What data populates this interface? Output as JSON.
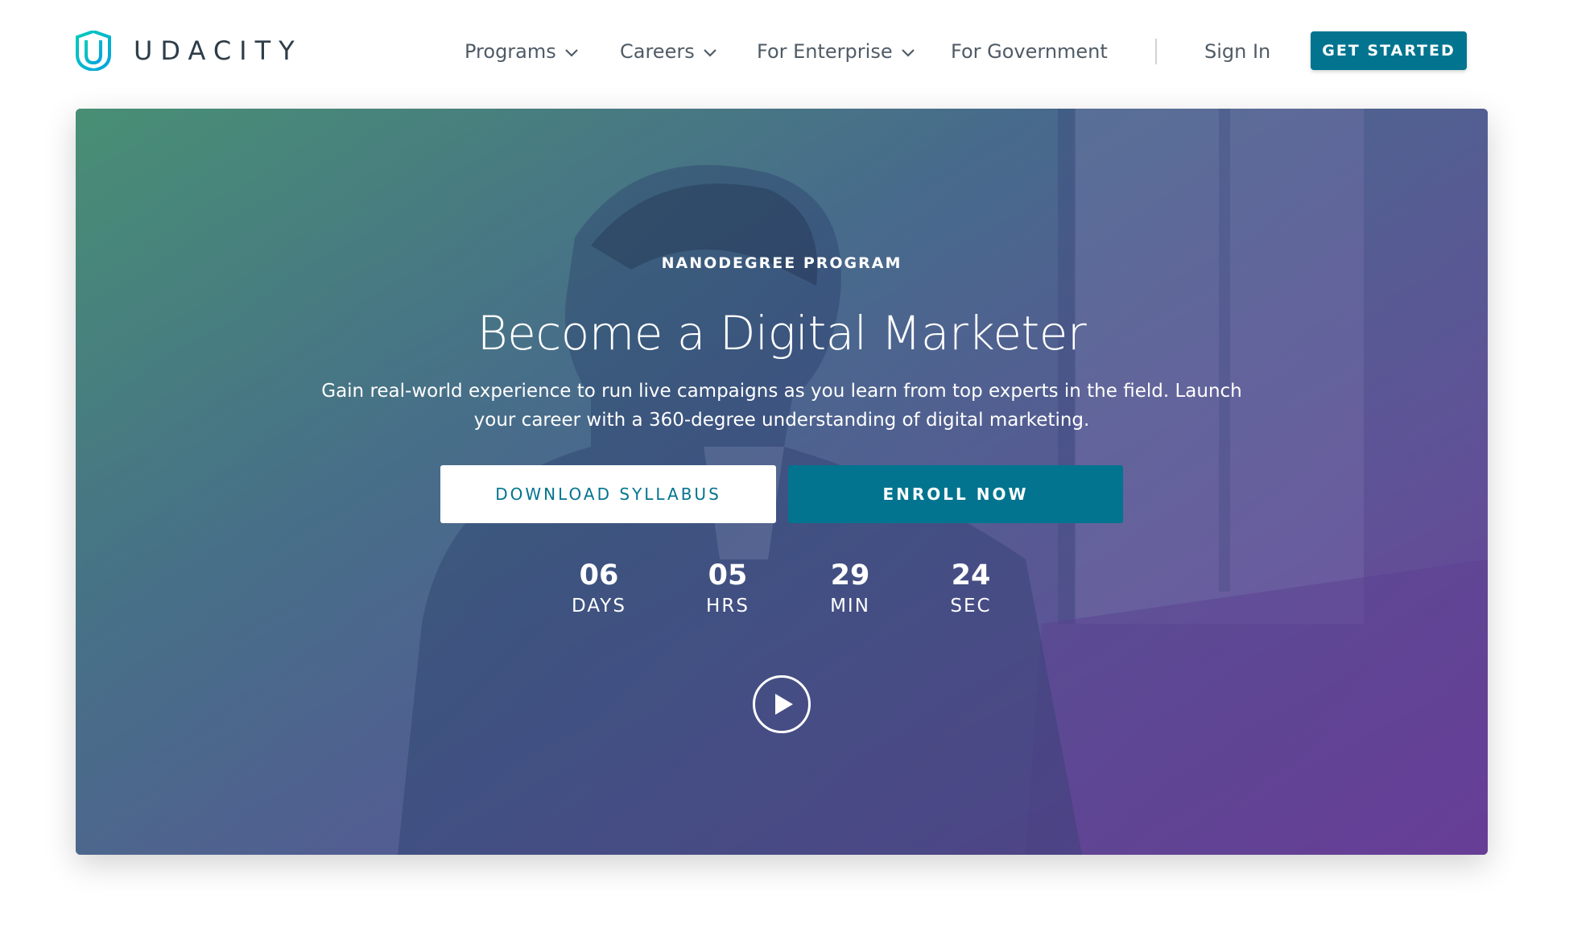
{
  "brand": {
    "name": "UDACITY",
    "icon": "udacity-u-logo",
    "color": "#02b3e4"
  },
  "nav": {
    "items": [
      {
        "label": "Programs",
        "has_dropdown": true
      },
      {
        "label": "Careers",
        "has_dropdown": true
      },
      {
        "label": "For Enterprise",
        "has_dropdown": true
      },
      {
        "label": "For Government",
        "has_dropdown": false
      }
    ],
    "sign_in": "Sign In",
    "cta": "GET STARTED"
  },
  "hero": {
    "eyebrow": "NANODEGREE PROGRAM",
    "title": "Become a Digital Marketer",
    "description": "Gain real-world experience to run live campaigns as you learn from top experts in the field. Launch your career with a 360-degree understanding of digital marketing.",
    "buttons": {
      "syllabus": "DOWNLOAD SYLLABUS",
      "enroll": "ENROLL NOW"
    },
    "countdown": [
      {
        "value": "06",
        "unit": "DAYS"
      },
      {
        "value": "05",
        "unit": "HRS"
      },
      {
        "value": "29",
        "unit": "MIN"
      },
      {
        "value": "24",
        "unit": "SEC"
      }
    ],
    "play_icon": "play-icon"
  },
  "colors": {
    "accent": "#02748f",
    "text": "#2e3d49",
    "nav_text": "#4f5b66",
    "hero_gradient_start": "#4e8e7a",
    "hero_gradient_end": "#6b3f94"
  }
}
